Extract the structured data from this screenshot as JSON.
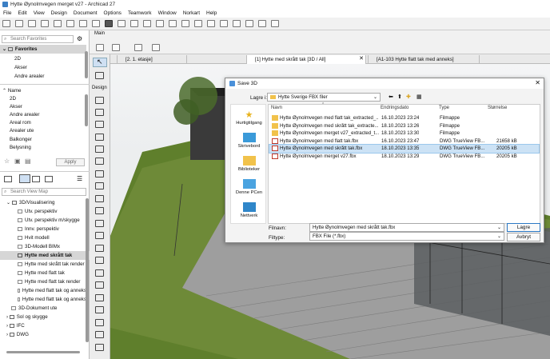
{
  "window": {
    "title": "Hytte Øynolmvegen merget v27 - Archicad 27"
  },
  "menu": [
    "File",
    "Edit",
    "View",
    "Design",
    "Document",
    "Options",
    "Teamwork",
    "Window",
    "Norkart",
    "Help"
  ],
  "toolbar": {
    "mode_label": "Main"
  },
  "nav": {
    "search_placeholder": "Search Favorites",
    "favorites_label": "Favorites",
    "favorites": [
      "2D",
      "Akser",
      "Andre arealer"
    ],
    "name_header": "Name",
    "names": [
      "2D",
      "Akser",
      "Andre arealer",
      "Areal rom",
      "Arealer ute",
      "Balkonger",
      "Belysning"
    ],
    "apply_label": "Apply",
    "view_search_placeholder": "Search View Map",
    "view_items": [
      "3D/Visualisering",
      "Utv. perspektiv",
      "Utv. perspektiv m/skygge",
      "Innv. perspektiv",
      "Hvit modell",
      "3D-Modell BIMx",
      "Hytte med skrått tak",
      "Hytte med skrått tak render",
      "Hytte med flatt tak",
      "Hytte med flatt tak render",
      "Hytte med flatt tak og anneks",
      "Hytte med flatt tak og anneks",
      "3D-Dokument ute",
      "Sol og skygge",
      "IFC",
      "DWG"
    ]
  },
  "toolbox": {
    "arrow_label": "Arrow",
    "design_label": "Design"
  },
  "tabs": [
    "[2. 1. etasje]",
    "[1] Hytte med skrått tak [3D / All]",
    "[A1-103 Hytte flatt tak med anneks]"
  ],
  "dialog": {
    "title": "Save 3D",
    "save_in_label": "Lagre i:",
    "folder": "Hytte Sverige FBX filer",
    "places": [
      "Hurtigtilgang",
      "Skrivebord",
      "Biblioteker",
      "Denne PCen",
      "Nettverk"
    ],
    "columns": [
      "Navn",
      "Endringsdato",
      "Type",
      "Størrelse"
    ],
    "files": [
      {
        "name": "Hytte Øynolmvegen med flatt tak_extracted_...",
        "date": "16.10.2023 23:24",
        "type": "Filmappe",
        "size": "",
        "kind": "folder"
      },
      {
        "name": "Hytte Øynolmvegen med skrått tak_extracte...",
        "date": "18.10.2023 13:26",
        "type": "Filmappe",
        "size": "",
        "kind": "folder"
      },
      {
        "name": "Hytte Øynolmvegen merget v27_extracted_t...",
        "date": "18.10.2023 13:30",
        "type": "Filmappe",
        "size": "",
        "kind": "folder"
      },
      {
        "name": "Hytte Øynolmvegen med flatt tak.fbx",
        "date": "16.10.2023 23:47",
        "type": "DWG TrueView FB...",
        "size": "21658 kB",
        "kind": "fbx"
      },
      {
        "name": "Hytte Øynolmvegen med skrått tak.fbx",
        "date": "18.10.2023 13:35",
        "type": "DWG TrueView FB...",
        "size": "20205 kB",
        "kind": "fbx"
      },
      {
        "name": "Hytte Øynolmvegen merget v27.fbx",
        "date": "18.10.2023 13:29",
        "type": "DWG TrueView FB...",
        "size": "20205 kB",
        "kind": "fbx"
      }
    ],
    "filename_label": "Filnavn:",
    "filename": "Hytte Øynolmvegen med skrått tak.fbx",
    "filetype_label": "Filtype:",
    "filetype": "FBX File (*.fbx)",
    "save_label": "Lagre",
    "cancel_label": "Avbryt"
  }
}
